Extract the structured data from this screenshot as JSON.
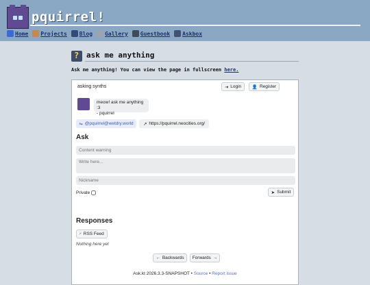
{
  "site": {
    "title": "pquirrel!"
  },
  "nav": [
    {
      "label": "Home",
      "color": "#3c6ad2"
    },
    {
      "label": "Projects",
      "color": "#c4894b"
    },
    {
      "label": "Blog",
      "color": "#2f4b7a"
    },
    {
      "label": "Gallery",
      "color": "#9da4ae"
    },
    {
      "label": "Guestbook",
      "color": "#3f4a5a"
    },
    {
      "label": "Askbox",
      "color": "#425173"
    }
  ],
  "page": {
    "title": "ask me anything",
    "intro": "Ask me anything! You can view the page in fullscreen",
    "intro_link": "here."
  },
  "box": {
    "header": "asking synths",
    "login": "Login",
    "register": "Register",
    "greeting": "meow! ask me anything :3",
    "signature": "- pquirrel",
    "handle": "@pquirrel@wetdry.world",
    "website": "https://pquirrel.neocities.org/",
    "ask_heading": "Ask",
    "content_warning_placeholder": "Content warning",
    "body_placeholder": "Write here...",
    "nickname_placeholder": "Nickname",
    "private_label": "Private",
    "submit": "Submit",
    "responses_heading": "Responses",
    "rss": "RSS Feed",
    "empty": "Nothing here yet",
    "backwards": "Backwards",
    "forwards": "Forwards",
    "footer_app": "Ask.kt 2026.3.3-SNAPSHOT",
    "footer_source": "Source",
    "footer_report": "Report issue"
  }
}
